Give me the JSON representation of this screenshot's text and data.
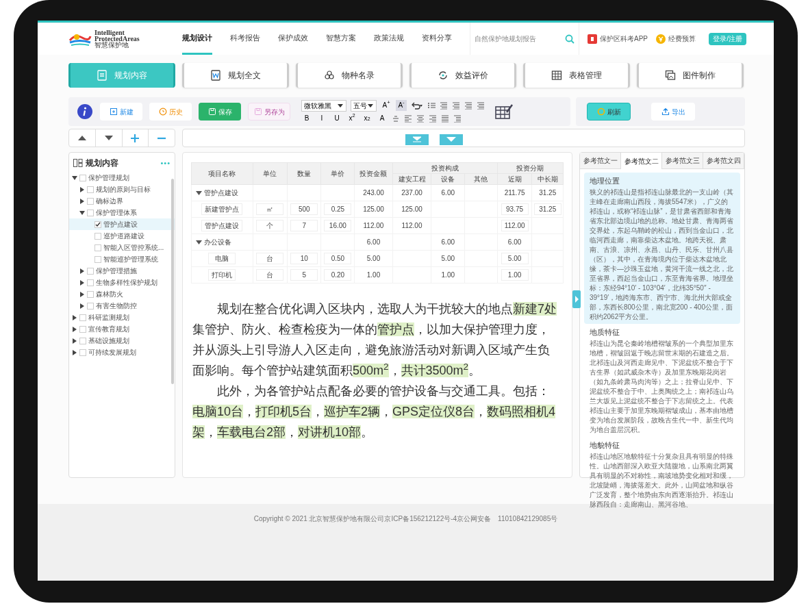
{
  "header": {
    "logo": {
      "line1": "Intelligent",
      "line2": "ProtectedAreas",
      "line3": "智慧保护地"
    },
    "nav": [
      {
        "label": "规划设计",
        "selected": true
      },
      {
        "label": "科考报告",
        "selected": false
      },
      {
        "label": "保护成效",
        "selected": false
      },
      {
        "label": "智慧方案",
        "selected": false
      },
      {
        "label": "政策法规",
        "selected": false
      },
      {
        "label": "资料分享",
        "selected": false
      }
    ],
    "search": {
      "placeholder": "自然保护地规划报告"
    },
    "links": [
      {
        "kind": "app",
        "label": "保护区科考APP"
      },
      {
        "kind": "budget",
        "label": "经费预算"
      }
    ],
    "login": "登录/注册"
  },
  "module_tabs": [
    {
      "label": "规划内容",
      "selected": true
    },
    {
      "label": "规划全文",
      "selected": false
    },
    {
      "label": "物种名录",
      "selected": false
    },
    {
      "label": "效益评价",
      "selected": false
    },
    {
      "label": "表格管理",
      "selected": false
    },
    {
      "label": "图件制作",
      "selected": false
    }
  ],
  "toolbar": {
    "actions": [
      {
        "kind": "new",
        "label": "新建",
        "disabled": false
      },
      {
        "kind": "history",
        "label": "历史",
        "disabled": false
      },
      {
        "kind": "save",
        "label": "保存",
        "disabled": false
      },
      {
        "kind": "saveas",
        "label": "另存为",
        "disabled": true
      }
    ],
    "font": "微软雅黑",
    "size": "五号",
    "text_buttons_top": [
      {
        "label": "A$^{+}$",
        "selected": false
      },
      {
        "label": "A$^{-}$",
        "selected": true
      }
    ],
    "text_buttons_bottom": [
      {
        "label": "B",
        "selected": false
      },
      {
        "label": "I",
        "selected": false
      },
      {
        "label": "U",
        "selected": false
      },
      {
        "label": "x$^{2}$",
        "selected": false
      },
      {
        "label": "x$_{2}$",
        "selected": false
      },
      {
        "label": "A",
        "selected": false
      }
    ],
    "right_actions": [
      {
        "kind": "refresh",
        "label": "刷新"
      },
      {
        "kind": "export",
        "label": "导出"
      }
    ]
  },
  "outline": {
    "title": "规划内容",
    "more": "•••",
    "items": [
      {
        "label": "保护管理规划",
        "expanded": true,
        "checked": false,
        "selected": false,
        "children": [
          {
            "label": "规划的原则与目标",
            "expanded": false,
            "checked": false,
            "selected": false
          },
          {
            "label": "确标边界",
            "expanded": false,
            "checked": false,
            "selected": false
          },
          {
            "label": "保护管理体系",
            "expanded": true,
            "checked": false,
            "selected": false,
            "children": [
              {
                "label": "管护点建设",
                "checked": true,
                "selected": true
              },
              {
                "label": "巡护道路建设",
                "checked": false,
                "selected": false
              },
              {
                "label": "智能入区管控系统...",
                "checked": false,
                "selected": false
              },
              {
                "label": "智能巡护管理系统",
                "checked": false,
                "selected": false
              }
            ]
          },
          {
            "label": "保护管理措施",
            "expanded": false,
            "checked": false,
            "selected": false
          },
          {
            "label": "生物多样性保护规划",
            "expanded": false,
            "checked": false,
            "selected": false
          },
          {
            "label": "森林防火",
            "expanded": false,
            "checked": false,
            "selected": false
          },
          {
            "label": "有害生物防控",
            "expanded": false,
            "checked": false,
            "selected": false
          }
        ]
      },
      {
        "label": "科研监测规划",
        "expanded": false,
        "checked": false,
        "selected": false
      },
      {
        "label": "宣传教育规划",
        "expanded": false,
        "checked": false,
        "selected": false
      },
      {
        "label": "基础设施规划",
        "expanded": false,
        "checked": false,
        "selected": false
      },
      {
        "label": "可持续发展规划",
        "expanded": false,
        "checked": false,
        "selected": false
      }
    ]
  },
  "table": {
    "header_rows": [
      [
        {
          "label": "项目名称",
          "rowspan": 2
        },
        {
          "label": "单位",
          "rowspan": 2
        },
        {
          "label": "数量",
          "rowspan": 2
        },
        {
          "label": "单价",
          "rowspan": 2
        },
        {
          "label": "投资金额",
          "rowspan": 2
        },
        {
          "label": "投资构成",
          "colspan": 3
        },
        {
          "label": "投资分期",
          "colspan": 2
        }
      ],
      [
        {
          "label": "建安工程"
        },
        {
          "label": "设备"
        },
        {
          "label": "其他"
        },
        {
          "label": "近期"
        },
        {
          "label": "中长期"
        }
      ]
    ],
    "rows": [
      {
        "kind": "group",
        "expanded": true,
        "cells": [
          "管护点建设",
          "",
          "",
          "",
          "243.00",
          "237.00",
          "6.00",
          "",
          "211.75",
          "31.25"
        ]
      },
      {
        "kind": "item",
        "cells": [
          "新建管护点",
          "㎡",
          "500",
          "0.25",
          "125.00",
          "125.00",
          "",
          "",
          "93.75",
          "31.25"
        ]
      },
      {
        "kind": "item",
        "cells": [
          "管护点建设",
          "个",
          "7",
          "16.00",
          "112.00",
          "112.00",
          "",
          "",
          "112.00",
          ""
        ]
      },
      {
        "kind": "group",
        "expanded": true,
        "cells": [
          "办公设备",
          "",
          "",
          "",
          "6.00",
          "",
          "6.00",
          "",
          "6.00",
          ""
        ]
      },
      {
        "kind": "item",
        "cells": [
          "电脑",
          "台",
          "10",
          "0.50",
          "5.00",
          "",
          "5.00",
          "",
          "5.00",
          ""
        ]
      },
      {
        "kind": "item",
        "cells": [
          "打印机",
          "台",
          "5",
          "0.20",
          "1.00",
          "",
          "1.00",
          "",
          "1.00",
          ""
        ]
      }
    ]
  },
  "body": [
    [
      {
        "text": "规划在整合优化调入区块内，选取人为干扰较大的地点",
        "highlighted": false
      },
      {
        "text": "新建7处",
        "highlighted": true
      },
      {
        "text": "集管护、防火、检查检疫为一体的",
        "highlighted": false
      },
      {
        "text": "管护点",
        "highlighted": true
      },
      {
        "text": "，以加大保护管理力度，并从源头上引导游人入区走向，避免旅游活动对新调入区域产生负面影响。每个管护站建筑面积",
        "highlighted": false
      },
      {
        "text": "500m$^{2}$",
        "highlighted": true
      },
      {
        "text": "，",
        "highlighted": false
      },
      {
        "text": "共计3500m$^{2}$",
        "highlighted": true
      },
      {
        "text": "。",
        "highlighted": false
      }
    ],
    [
      {
        "text": "此外，为各管护站点配备必要的管护设备与交通工具。包括：",
        "highlighted": false
      },
      {
        "text": "电脑10台",
        "highlighted": true
      },
      {
        "text": "，",
        "highlighted": false
      },
      {
        "text": "打印机5台",
        "highlighted": true
      },
      {
        "text": "，",
        "highlighted": false
      },
      {
        "text": "巡护车2辆",
        "highlighted": true
      },
      {
        "text": "，",
        "highlighted": false
      },
      {
        "text": "GPS定位仪8台",
        "highlighted": true
      },
      {
        "text": "，",
        "highlighted": false
      },
      {
        "text": "数码照相机4架",
        "highlighted": true
      },
      {
        "text": "，",
        "highlighted": false
      },
      {
        "text": "车载电台2部",
        "highlighted": true
      },
      {
        "text": "，",
        "highlighted": false
      },
      {
        "text": "对讲机10部",
        "highlighted": true
      },
      {
        "text": "。",
        "highlighted": false
      }
    ]
  ],
  "reference": {
    "tabs": [
      {
        "label": "参考范文一",
        "selected": false
      },
      {
        "label": "参考范文二",
        "selected": true
      },
      {
        "label": "参考范文三",
        "selected": false
      },
      {
        "label": "参考范文四",
        "selected": false
      }
    ],
    "sections": [
      {
        "heading": "地理位置",
        "highlighted": true,
        "text": "狭义的祁连山是指祁连山脉最北的一支山岭（其主峰在走廊南山西段，海拔5547米），广义的祁连山，或称“祁连山脉”，是甘肃省西部和青海省东北部边境山地的总称。地处甘肃、青海两省交界处，东起乌鞘岭的松山，西到当金山口，北临河西走廊，南靠柴达木盆地。地跨天祝、肃南、古浪、凉州、永昌、山丹、民乐、甘州八县（区），其中，在青海境内位于柴达木盆地北缘，茶卡—沙珠玉盆地，黄河干流一线之北，北至省界，西起当金山口，东至青海省界。地理坐标：东经94°10′ - 103°04′，北纬35°50′′ - 39°19′，地跨海东市、西宁市、海北州大部或全部，东西长800公里，南北宽200 - 400公里，面积约2062平方公里。"
      },
      {
        "heading": "地质特征",
        "highlighted": false,
        "text": "祁连山为昆仑秦岭地槽褶皱系的一个典型加里东地槽，褶皱回返于晚志留世末期的石建造之后。北祁连山及河西走廊见中、下泥盆统不整合于下古生界（如武威杂木寺）及加里东晚期花岗岩（如九条岭肃马肉沟等）之上；拉脊山见中、下泥盆统不整合于中、上奥陶统之上；南祁连山乌兰大坂见上泥盆统不整合于下志留统之上。代表祁连山主要于加里东晚期褶皱成山，基本由地槽变为地台发展阶段，故晚古生代一中、新生代均为地台盖层沉积。"
      },
      {
        "heading": "地貌特征",
        "highlighted": false,
        "text": "祁连山地区地貌特征十分复杂且具有明显的特殊性。山地西部深入欧亚大陆腹地，山系南北两翼具有明显的不对称性，南坡地势变化相对和缓，北坡陡峭，海拔落差大。此外，山间盆地和纵谷广泛发育，整个地势由东向西逐渐抬升。祁连山脉西段自：走廊南山、黑河谷地、"
      }
    ]
  },
  "footer": "Copyright © 2021 北京智慧保护地有限公司京ICP备156212122号-4京公网安备　11010842129085号"
}
